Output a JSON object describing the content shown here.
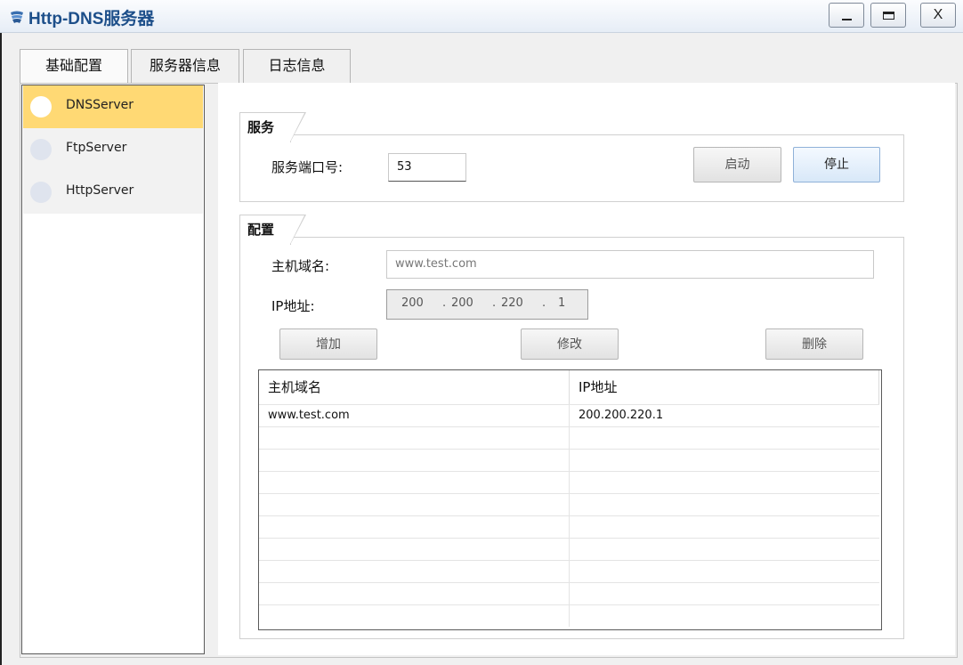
{
  "window": {
    "title": "Http-DNS服务器",
    "min_label": "_",
    "max_label": "",
    "close_label": "X"
  },
  "tabs": [
    {
      "label": "基础配置"
    },
    {
      "label": "服务器信息"
    },
    {
      "label": "日志信息"
    }
  ],
  "sidebar": {
    "items": [
      {
        "label": "DNSServer",
        "active": true
      },
      {
        "label": "FtpServer",
        "active": false
      },
      {
        "label": "HttpServer",
        "active": false
      }
    ]
  },
  "service": {
    "group_title": "服务",
    "port_label": "服务端口号:",
    "port_value": "53",
    "start_label": "启动",
    "stop_label": "停止"
  },
  "config": {
    "group_title": "配置",
    "domain_label": "主机域名:",
    "domain_value": "www.test.com",
    "ip_label": "IP地址:",
    "ip_octets": [
      "200",
      "200",
      "220",
      "1"
    ],
    "ip_dot": ".",
    "add_label": "增加",
    "modify_label": "修改",
    "delete_label": "删除"
  },
  "table": {
    "headers": [
      "主机域名",
      "IP地址"
    ],
    "rows": [
      {
        "domain": "www.test.com",
        "ip": "200.200.220.1"
      }
    ]
  },
  "colors": {
    "active_item": "#ffd974",
    "title_text": "#1d4f8a",
    "primary_button": "#d8e8f8"
  }
}
